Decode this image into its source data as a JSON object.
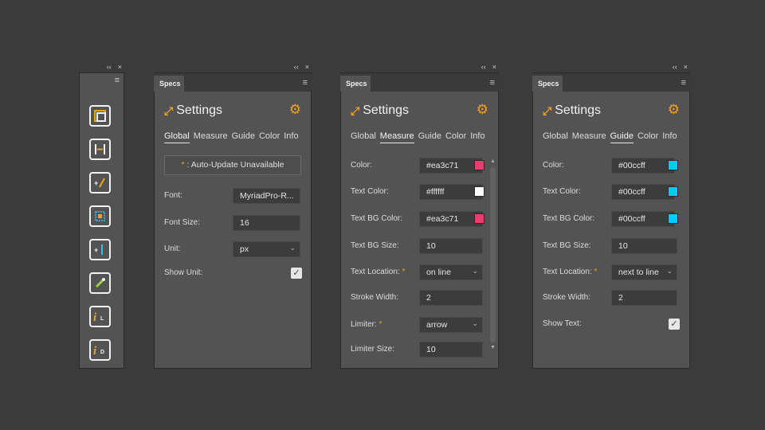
{
  "panel_controls": {
    "collapse": "‹‹",
    "close": "×",
    "menu": "≡"
  },
  "toolbar": {
    "tools": [
      {
        "name": "spec-tool-bounds-icon",
        "glyph": ""
      },
      {
        "name": "spec-tool-width-icon",
        "glyph": "|–|"
      },
      {
        "name": "spec-tool-add-text-icon",
        "glyph": "+/"
      },
      {
        "name": "spec-tool-select-icon",
        "glyph": ""
      },
      {
        "name": "spec-tool-add-line-icon",
        "glyph": "+|"
      },
      {
        "name": "spec-tool-eyedropper-icon",
        "glyph": ""
      },
      {
        "name": "spec-tool-info-l-icon",
        "glyph": "iL"
      },
      {
        "name": "spec-tool-info-d-icon",
        "glyph": "iD"
      }
    ]
  },
  "colors": {
    "accent": "#f0a21b",
    "panel_bg": "#535353",
    "field_bg": "#3c3c3c",
    "pink": "#ea3c71",
    "white": "#ffffff",
    "cyan": "#00ccff"
  },
  "panels": {
    "global": {
      "tab_name": "Specs",
      "title": "Settings",
      "tabs": [
        "Global",
        "Measure",
        "Guide",
        "Color",
        "Info"
      ],
      "active_tab": "Global",
      "auto_update": "* : Auto-Update Unavailable",
      "font_label": "Font:",
      "font_value": "MyriadPro-R...",
      "font_size_label": "Font Size:",
      "font_size_value": "16",
      "unit_label": "Unit:",
      "unit_value": "px",
      "show_unit_label": "Show Unit:",
      "show_unit_checked": true
    },
    "measure": {
      "tab_name": "Specs",
      "title": "Settings",
      "tabs": [
        "Global",
        "Measure",
        "Guide",
        "Color",
        "Info"
      ],
      "active_tab": "Measure",
      "color_label": "Color:",
      "color_value": "#ea3c71",
      "text_color_label": "Text Color:",
      "text_color_value": "#ffffff",
      "text_bg_color_label": "Text BG Color:",
      "text_bg_color_value": "#ea3c71",
      "text_bg_size_label": "Text BG Size:",
      "text_bg_size_value": "10",
      "text_location_label": "Text Location:",
      "text_location_value": "on line",
      "stroke_width_label": "Stroke Width:",
      "stroke_width_value": "2",
      "limiter_label": "Limiter:",
      "limiter_value": "arrow",
      "limiter_size_label": "Limiter Size:",
      "limiter_size_value": "10"
    },
    "guide": {
      "tab_name": "Specs",
      "title": "Settings",
      "tabs": [
        "Global",
        "Measure",
        "Guide",
        "Color",
        "Info"
      ],
      "active_tab": "Guide",
      "color_label": "Color:",
      "color_value": "#00ccff",
      "text_color_label": "Text Color:",
      "text_color_value": "#00ccff",
      "text_bg_color_label": "Text BG Color:",
      "text_bg_color_value": "#00ccff",
      "text_bg_size_label": "Text BG Size:",
      "text_bg_size_value": "10",
      "text_location_label": "Text Location:",
      "text_location_value": "next to line",
      "stroke_width_label": "Stroke Width:",
      "stroke_width_value": "2",
      "show_text_label": "Show Text:",
      "show_text_checked": true
    }
  }
}
